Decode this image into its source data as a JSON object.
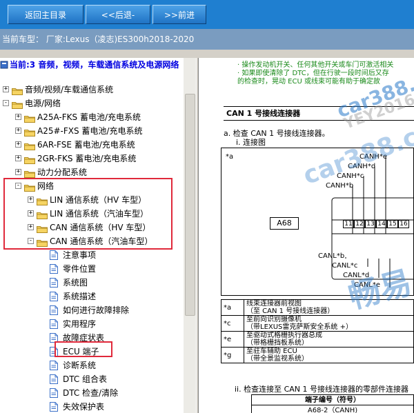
{
  "toolbar": {
    "home_label": "返回主目录",
    "back_label": "<<后退-",
    "forward_label": ">>前进"
  },
  "status": {
    "current_model": "当前车型：  厂家:Lexus（凌志)ES300h2018-2020"
  },
  "left_panel": {
    "current_path": "当前:3 音频，视频，车载通信系统及电源网络",
    "tree": [
      {
        "label": "音频/视频/车载通信系统",
        "level": 0,
        "type": "folder",
        "toggle": "+"
      },
      {
        "label": "电源/网络",
        "level": 0,
        "type": "folder",
        "toggle": "-"
      },
      {
        "label": "A25A-FKS 蓄电池/充电系统",
        "level": 1,
        "type": "folder",
        "toggle": "+"
      },
      {
        "label": "A25#-FXS 蓄电池/充电系统",
        "level": 1,
        "type": "folder",
        "toggle": "+"
      },
      {
        "label": "6AR-FSE 蓄电池/充电系统",
        "level": 1,
        "type": "folder",
        "toggle": "+"
      },
      {
        "label": "2GR-FKS 蓄电池/充电系统",
        "level": 1,
        "type": "folder",
        "toggle": "+"
      },
      {
        "label": "动力分配系统",
        "level": 1,
        "type": "folder",
        "toggle": "+"
      },
      {
        "label": "网络",
        "level": 1,
        "type": "folder",
        "toggle": "-"
      },
      {
        "label": "LIN 通信系统（HV 车型）",
        "level": 2,
        "type": "folder",
        "toggle": "+"
      },
      {
        "label": "LIN 通信系统（汽油车型）",
        "level": 2,
        "type": "folder",
        "toggle": "+"
      },
      {
        "label": "CAN 通信系统（HV 车型）",
        "level": 2,
        "type": "folder",
        "toggle": "+"
      },
      {
        "label": "CAN 通信系统（汽油车型）",
        "level": 2,
        "type": "folder",
        "toggle": "-"
      },
      {
        "label": "注意事项",
        "level": 3,
        "type": "doc"
      },
      {
        "label": "零件位置",
        "level": 3,
        "type": "doc"
      },
      {
        "label": "系统图",
        "level": 3,
        "type": "doc"
      },
      {
        "label": "系统描述",
        "level": 3,
        "type": "doc"
      },
      {
        "label": "如何进行故障排除",
        "level": 3,
        "type": "doc"
      },
      {
        "label": "实用程序",
        "level": 3,
        "type": "doc"
      },
      {
        "label": "故障症状表",
        "level": 3,
        "type": "doc"
      },
      {
        "label": "ECU 端子",
        "level": 3,
        "type": "doc",
        "selected": true
      },
      {
        "label": "诊断系统",
        "level": 3,
        "type": "doc"
      },
      {
        "label": "DTC 组合表",
        "level": 3,
        "type": "doc"
      },
      {
        "label": "DTC 检查/清除",
        "level": 3,
        "type": "doc"
      },
      {
        "label": "失效保护表",
        "level": 3,
        "type": "doc"
      }
    ]
  },
  "document": {
    "notes": [
      "·  操作发动机开关、任何其他开关或车门可激活相关",
      "·  如果即使清除了 DTC，但在行驶一段时间后又存",
      "   的检查时，晃动 ECU 或线束可能有助于确定故"
    ],
    "section_title": "CAN 1 号接线连接器",
    "step_a": "a.   检查 CAN 1 号接线连接器。",
    "step_a_i": "i.   连接图",
    "diagram_ref": "*a",
    "connector_id": "A68",
    "pin_labels": [
      "CANH*e",
      "CANH*d",
      "CANH*c",
      "CANH*b",
      "CANL*b",
      "CANL*c",
      "CANL*d",
      "CANL*e"
    ],
    "pin_numbers_top": [
      "11",
      "12",
      "13",
      "14",
      "15",
      "16"
    ],
    "legend": [
      {
        "key": "*a",
        "text": "线束连接器前视图\n（至 CAN 1 号接线连接器）"
      },
      {
        "key": "*c",
        "text": "至前向识别摄像机\n（带LEXUS雷克萨斯安全系统 +）"
      },
      {
        "key": "*e",
        "text": "至驱动式格栅执行器总成\n（带格栅挡板系统）"
      },
      {
        "key": "*g",
        "text": "至驻车辅助 ECU\n（带全景监视系统）"
      }
    ],
    "step_ii": "ii.   检查连接至 CAN 1 号接线连接器的零部件连接器",
    "table_header": "端子编号（符号）",
    "table_row": "A68-2（CANH)"
  },
  "watermarks": [
    "car388.com",
    "YEY2016",
    "畅易"
  ],
  "colors": {
    "toolbar": "#1f7fd0",
    "status_bar": "#7a9cc0",
    "highlight_box": "#e0283a",
    "current_path": "#0000e0",
    "note_text": "#1a8a1a"
  }
}
